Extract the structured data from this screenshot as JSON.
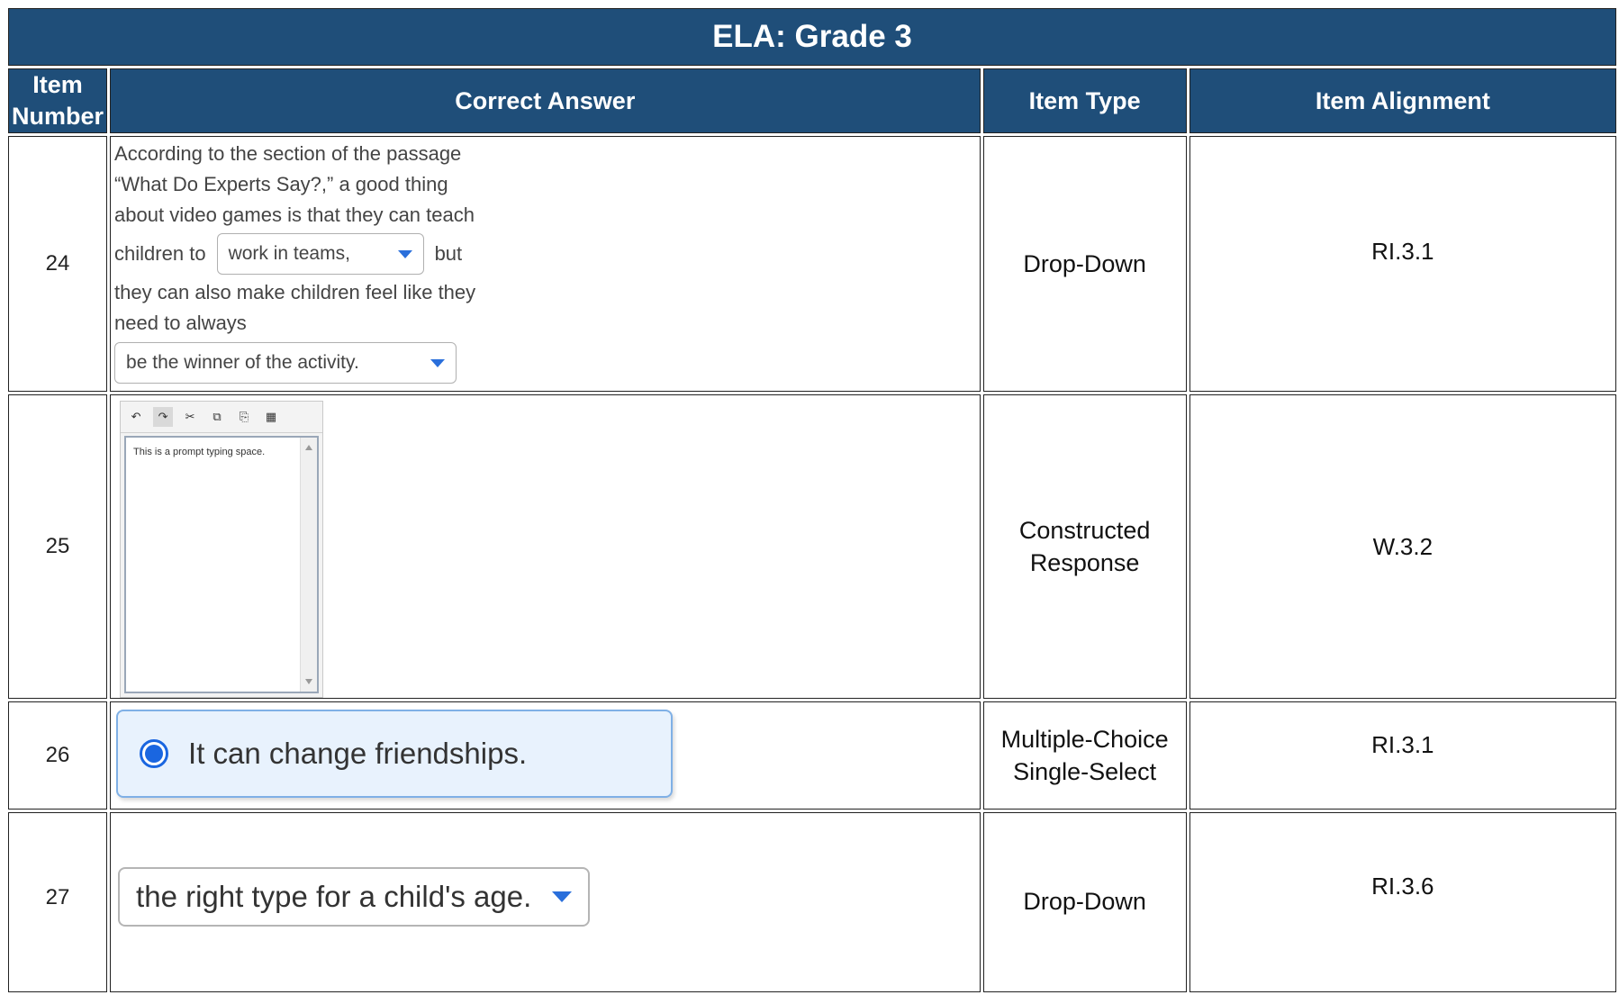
{
  "title": "ELA: Grade 3",
  "headers": {
    "item_number": "Item Number",
    "correct_answer": "Correct Answer",
    "item_type": "Item Type",
    "item_alignment": "Item Alignment"
  },
  "rows": [
    {
      "number": "24",
      "passage": {
        "line1": "According to the section of the passage",
        "line2": "“What Do Experts Say?,” a good thing",
        "line3": "about video games is that they can teach",
        "before_dropdown": "children to",
        "dropdown1": "work in teams,",
        "after_dropdown": "but",
        "line5": "they can also make children feel like they",
        "line6": "need to always",
        "dropdown2": "be the winner of the activity."
      },
      "type": "Drop-Down",
      "alignment": "RI.3.1"
    },
    {
      "number": "25",
      "editor_text": "This is a prompt typing space.",
      "type_line1": "Constructed",
      "type_line2": "Response",
      "alignment": "W.3.2"
    },
    {
      "number": "26",
      "choice": "It can change friendships.",
      "type_line1": "Multiple-Choice",
      "type_line2": "Single-Select",
      "alignment": "RI.3.1"
    },
    {
      "number": "27",
      "dropdown": "the right type for a child's age.",
      "type": "Drop-Down",
      "alignment": "RI.3.6"
    }
  ],
  "colors": {
    "header_bg": "#1f4e79",
    "accent": "#1a66e0"
  }
}
